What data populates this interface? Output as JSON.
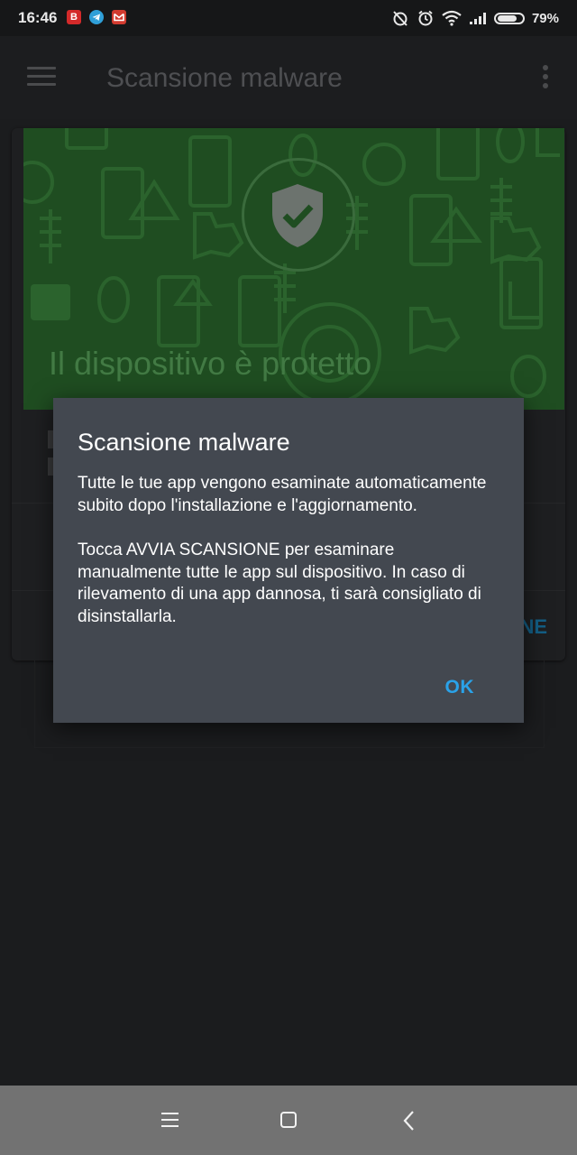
{
  "status_bar": {
    "time": "16:46",
    "notification_icons": [
      "b-app-icon",
      "telegram-icon",
      "gmail-icon"
    ],
    "system_icons": [
      "alarm-off-icon",
      "alarm-clock-icon",
      "wifi-icon",
      "signal-icon",
      "battery-icon"
    ],
    "battery_level": 0.79,
    "battery_text": "79%"
  },
  "app_bar": {
    "title": "Scansione malware",
    "menu_icon": "hamburger-menu-icon",
    "overflow_icon": "more-vert-icon"
  },
  "card": {
    "banner_text": "Il dispositivo è protetto",
    "banner_icon": "shield-check-icon",
    "action_label_partial": "NE"
  },
  "dialog": {
    "title": "Scansione malware",
    "paragraph1": "Tutte le tue app vengono esaminate automaticamente subito dopo l'installazione e l'aggiornamento.",
    "paragraph2": "Tocca AVVIA SCANSIONE per esaminare manualmente tutte le app sul dispositivo. In caso di rilevamento di una app dannosa, ti sarà consigliato di disinstallarla.",
    "ok_label": "OK"
  },
  "nav_bar": {
    "icons": [
      "recent-apps-icon",
      "home-icon",
      "back-icon"
    ]
  },
  "colors": {
    "banner_green": "#1f4d21",
    "dialog_bg": "#434850",
    "accent_blue": "#2aa2e8"
  }
}
